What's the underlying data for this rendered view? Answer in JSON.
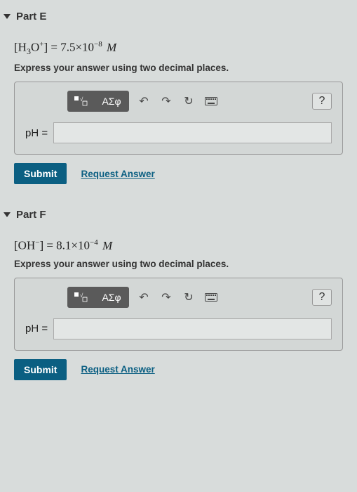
{
  "parts": [
    {
      "title": "Part E",
      "equation_html": "[H<sub>3</sub>O<sup>+</sup>] = 7.5×10<sup>−8</sup> <span class='unit'>M</span>",
      "instruction": "Express your answer using two decimal places.",
      "label": "pH =",
      "input_value": "",
      "submit": "Submit",
      "request": "Request Answer",
      "tool_greek": "ΑΣφ",
      "tool_help": "?"
    },
    {
      "title": "Part F",
      "equation_html": "[OH<sup>−</sup>] = 8.1×10<sup>−4</sup> <span class='unit'>M</span>",
      "instruction": "Express your answer using two decimal places.",
      "label": "pH =",
      "input_value": "",
      "submit": "Submit",
      "request": "Request Answer",
      "tool_greek": "ΑΣφ",
      "tool_help": "?"
    }
  ]
}
